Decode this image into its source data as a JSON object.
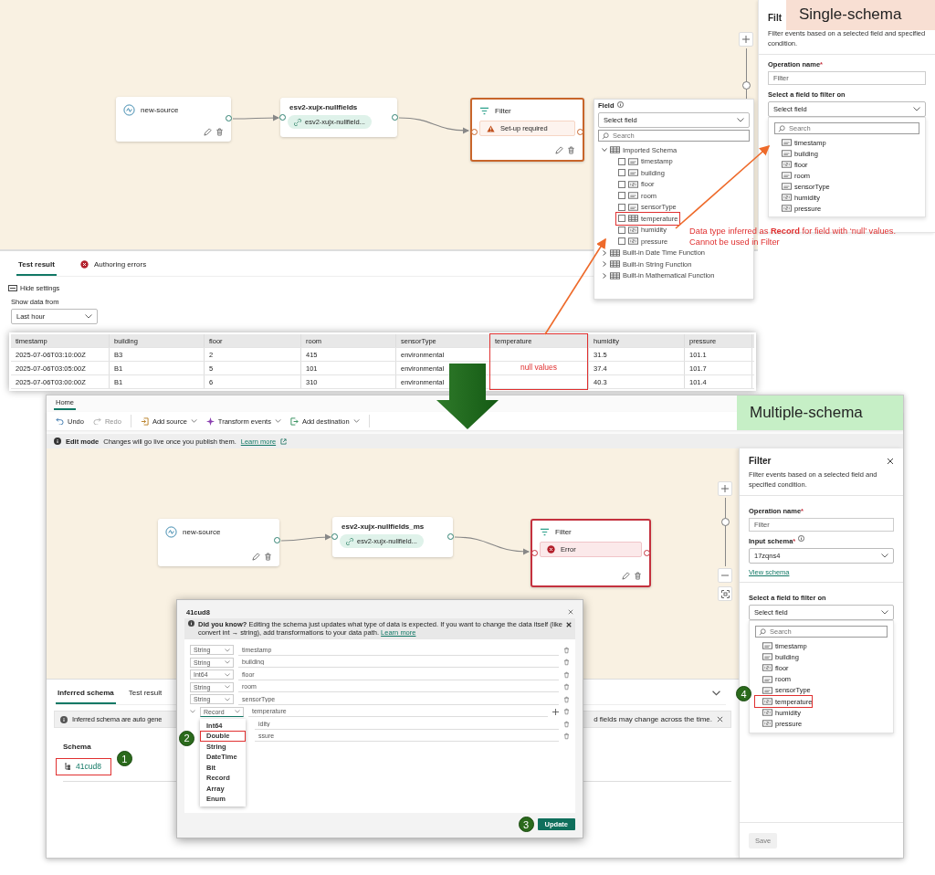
{
  "single_schema": {
    "label": "Single-schema",
    "nodes": [
      {
        "kind": "source",
        "title": "new-source"
      },
      {
        "kind": "stream",
        "title": "esv2-xujx-nullfields",
        "chip": "esv2-xujx-nullfield..."
      },
      {
        "kind": "operation",
        "title": "Filter",
        "message": {
          "kind": "warning",
          "text": "Set-up required"
        }
      }
    ],
    "zoom": {
      "level": 0.55
    },
    "bottom_tabs": [
      {
        "label": "Test result",
        "selected": true,
        "error": false
      },
      {
        "label": "Authoring errors",
        "selected": false,
        "error": true
      }
    ],
    "hide_settings": "Hide settings",
    "show_data_from": {
      "label": "Show data from",
      "value": "Last hour"
    },
    "table": {
      "columns": [
        {
          "label": "timestamp",
          "highlighted": false
        },
        {
          "label": "building",
          "highlighted": false
        },
        {
          "label": "floor",
          "highlighted": false
        },
        {
          "label": "room",
          "highlighted": false
        },
        {
          "label": "sensorType",
          "highlighted": false
        },
        {
          "label": "temperature",
          "highlighted": true
        },
        {
          "label": "humidity",
          "highlighted": false
        },
        {
          "label": "pressure",
          "highlighted": false
        }
      ],
      "rows": [
        [
          "2025-07-06T03:10:00Z",
          "B3",
          "2",
          "415",
          "environmental",
          null,
          "31.5",
          "101.1"
        ],
        [
          "2025-07-06T03:05:00Z",
          "B1",
          "5",
          "101",
          "environmental",
          null,
          "37.4",
          "101.7"
        ],
        [
          "2025-07-06T03:00:00Z",
          "B1",
          "6",
          "310",
          "environmental",
          null,
          "40.3",
          "101.4"
        ]
      ],
      "note": "null values"
    },
    "field_dropdown": {
      "label": "Field",
      "placeholder": "Select field",
      "search_placeholder": "Search",
      "groups": [
        {
          "label": "Imported Schema",
          "expanded": true,
          "children": [
            {
              "label": "timestamp",
              "kind": "string",
              "checked": false,
              "highlighted": false
            },
            {
              "label": "building",
              "kind": "string",
              "checked": false,
              "highlighted": false
            },
            {
              "label": "floor",
              "kind": "number",
              "checked": false,
              "highlighted": false
            },
            {
              "label": "room",
              "kind": "string",
              "checked": false,
              "highlighted": false
            },
            {
              "label": "sensorType",
              "kind": "string",
              "checked": false,
              "highlighted": false
            },
            {
              "label": "temperature",
              "kind": "record",
              "checked": false,
              "highlighted": true
            },
            {
              "label": "humidity",
              "kind": "number",
              "checked": false,
              "highlighted": false
            },
            {
              "label": "pressure",
              "kind": "number",
              "checked": false,
              "highlighted": false
            }
          ]
        },
        {
          "label": "Built-in Date Time Function",
          "expanded": false
        },
        {
          "label": "Built-in String Function",
          "expanded": false
        },
        {
          "label": "Built-in Mathematical Function",
          "expanded": false
        }
      ]
    },
    "filter_panel": {
      "title": "Filt",
      "description": "Filter events based on a selected field and specified condition.",
      "operation_name": {
        "label": "Operation name",
        "required_mark": "*",
        "value": "Filter"
      },
      "field_select": {
        "label": "Select a field to filter on",
        "placeholder": "Select field",
        "search_placeholder": "Search",
        "options": [
          {
            "label": "timestamp",
            "kind": "string"
          },
          {
            "label": "building",
            "kind": "string"
          },
          {
            "label": "floor",
            "kind": "number"
          },
          {
            "label": "room",
            "kind": "string"
          },
          {
            "label": "sensorType",
            "kind": "string"
          },
          {
            "label": "humidity",
            "kind": "number"
          },
          {
            "label": "pressure",
            "kind": "number"
          }
        ]
      }
    },
    "annotation": "Data type inferred as **Record** for field with ‘null’ values. Cannot be used in Filter"
  },
  "multiple_schema": {
    "label": "Multiple-schema",
    "ribbon_tabs": [
      {
        "label": "Home",
        "selected": true
      }
    ],
    "toolbar": [
      {
        "kind": "undo",
        "label": "Undo",
        "disabled": false,
        "dropdown": false
      },
      {
        "kind": "redo",
        "label": "Redo",
        "disabled": true,
        "dropdown": false
      },
      {
        "kind": "source",
        "label": "Add source",
        "disabled": false,
        "dropdown": true
      },
      {
        "kind": "transform",
        "label": "Transform events",
        "disabled": false,
        "dropdown": true
      },
      {
        "kind": "destination",
        "label": "Add destination",
        "disabled": false,
        "dropdown": true
      }
    ],
    "edit_bar": {
      "title": "Edit mode",
      "message": "Changes will go live once you publish them.",
      "link": "Learn more"
    },
    "nodes": [
      {
        "kind": "source",
        "title": "new-source"
      },
      {
        "kind": "stream",
        "title": "esv2-xujx-nullfields_ms",
        "chip": "esv2-xujx-nullfield..."
      },
      {
        "kind": "operation",
        "title": "Filter",
        "message": {
          "kind": "error",
          "text": "Error"
        }
      }
    ],
    "zoom": {
      "level": 0.64
    },
    "bottom_tabs": [
      {
        "label": "Inferred schema",
        "selected": true
      },
      {
        "label": "Test result",
        "selected": false
      }
    ],
    "info_bar": {
      "start": "Inferred schema are auto gene",
      "end": "d fields may change across the time."
    },
    "schema": {
      "heading": "Schema",
      "items": [
        {
          "label": "41cud8",
          "highlighted": true,
          "step": "1"
        }
      ]
    },
    "dialog": {
      "title": "41cud8",
      "tip": "**Did you know?** Editing the schema just updates what type of data is expected. If you want to change the data itself (like convert int → string), add transformations to your data path.",
      "tip_link": "Learn more",
      "fields": [
        {
          "type": "String",
          "name": "timestamp",
          "expandable": false
        },
        {
          "type": "String",
          "name": "building",
          "expandable": false
        },
        {
          "type": "Int64",
          "name": "floor",
          "expandable": false
        },
        {
          "type": "String",
          "name": "room",
          "expandable": false
        },
        {
          "type": "String",
          "name": "sensorType",
          "expandable": false
        },
        {
          "type": "Record",
          "name": "temperature",
          "expandable": true
        },
        {
          "name": "idity",
          "expandable": false
        },
        {
          "name": "ssure",
          "expandable": false
        }
      ],
      "type_menu": {
        "step": "2",
        "options": [
          {
            "label": "Int64",
            "selected": false
          },
          {
            "label": "Double",
            "selected": true
          },
          {
            "label": "String",
            "selected": false
          },
          {
            "label": "DateTime",
            "selected": false
          },
          {
            "label": "Bit",
            "selected": false
          },
          {
            "label": "Record",
            "selected": false
          },
          {
            "label": "Array",
            "selected": false
          },
          {
            "label": "Enum",
            "selected": false
          }
        ]
      },
      "update_button": "Update",
      "update_step": "3"
    },
    "filter_panel": {
      "title": "Filter",
      "description": "Filter events based on a selected field and specified condition.",
      "operation_name": {
        "label": "Operation name",
        "required_mark": "*",
        "value": "Filter"
      },
      "input_schema": {
        "label": "Input schema",
        "required_mark": "*",
        "value": "17zqns4"
      },
      "view_schema": "View schema",
      "field_select": {
        "label": "Select a field to filter on",
        "placeholder": "Select field",
        "search_placeholder": "Search",
        "step": "4",
        "options": [
          {
            "label": "timestamp",
            "kind": "string",
            "highlighted": false
          },
          {
            "label": "building",
            "kind": "string",
            "highlighted": false
          },
          {
            "label": "floor",
            "kind": "number",
            "highlighted": false
          },
          {
            "label": "room",
            "kind": "string",
            "highlighted": false
          },
          {
            "label": "sensorType",
            "kind": "string",
            "highlighted": false
          },
          {
            "label": "temperature",
            "kind": "number",
            "highlighted": true
          },
          {
            "label": "humidity",
            "kind": "number",
            "highlighted": false
          },
          {
            "label": "pressure",
            "kind": "number",
            "highlighted": false
          }
        ]
      },
      "save_button": {
        "label": "Save",
        "disabled": true
      }
    }
  }
}
